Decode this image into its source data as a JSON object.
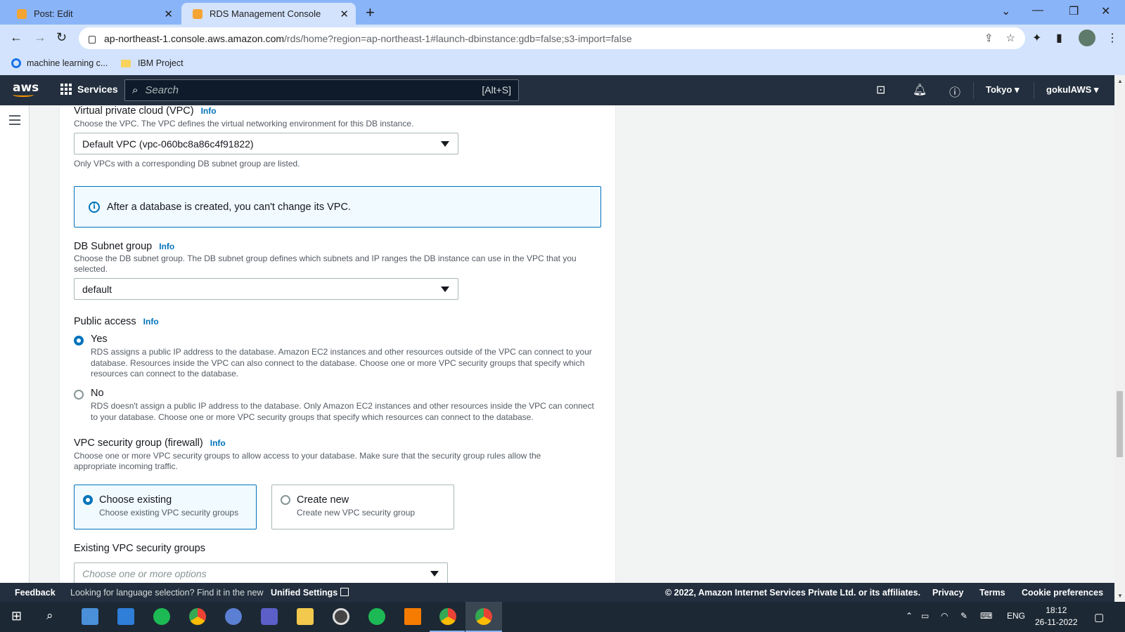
{
  "browser": {
    "tabs": [
      {
        "title": "Post: Edit",
        "favicon_color": "#f4a433"
      },
      {
        "title": "RDS Management Console",
        "favicon_color": "#f4a433"
      }
    ],
    "url_host": "ap-northeast-1.console.aws.amazon.com",
    "url_path": "/rds/home?region=ap-northeast-1#launch-dbinstance:gdb=false;s3-import=false",
    "bookmarks": [
      "machine learning c...",
      "IBM Project"
    ]
  },
  "aws_header": {
    "logo": "aws",
    "services_label": "Services",
    "search_placeholder": "Search",
    "search_shortcut": "[Alt+S]",
    "region": "Tokyo",
    "account": "gokulAWS"
  },
  "form": {
    "vpc": {
      "label": "Virtual private cloud (VPC)",
      "info": "Info",
      "description": "Choose the VPC. The VPC defines the virtual networking environment for this DB instance.",
      "value": "Default VPC (vpc-060bc8a86c4f91822)",
      "hint": "Only VPCs with a corresponding DB subnet group are listed.",
      "alert": "After a database is created, you can't change its VPC."
    },
    "subnet": {
      "label": "DB Subnet group",
      "info": "Info",
      "description": "Choose the DB subnet group. The DB subnet group defines which subnets and IP ranges the DB instance can use in the VPC that you selected.",
      "value": "default"
    },
    "public_access": {
      "label": "Public access",
      "info": "Info",
      "options": [
        {
          "label": "Yes",
          "checked": true,
          "description": "RDS assigns a public IP address to the database. Amazon EC2 instances and other resources outside of the VPC can connect to your database. Resources inside the VPC can also connect to the database. Choose one or more VPC security groups that specify which resources can connect to the database."
        },
        {
          "label": "No",
          "checked": false,
          "description": "RDS doesn't assign a public IP address to the database. Only Amazon EC2 instances and other resources inside the VPC can connect to your database. Choose one or more VPC security groups that specify which resources can connect to the database."
        }
      ]
    },
    "security_group": {
      "label": "VPC security group (firewall)",
      "info": "Info",
      "description": "Choose one or more VPC security groups to allow access to your database. Make sure that the security group rules allow the appropriate incoming traffic.",
      "tiles": [
        {
          "title": "Choose existing",
          "subtitle": "Choose existing VPC security groups",
          "selected": true
        },
        {
          "title": "Create new",
          "subtitle": "Create new VPC security group",
          "selected": false
        }
      ]
    },
    "existing_groups": {
      "label": "Existing VPC security groups",
      "placeholder": "Choose one or more options"
    }
  },
  "footer": {
    "feedback": "Feedback",
    "language_text": "Looking for language selection? Find it in the new",
    "unified_settings": "Unified Settings",
    "copyright": "© 2022, Amazon Internet Services Private Ltd. or its affiliates.",
    "links": [
      "Privacy",
      "Terms",
      "Cookie preferences"
    ]
  },
  "taskbar": {
    "language": "ENG",
    "time": "18:12",
    "date": "26-11-2022"
  },
  "colors": {
    "aws_nav": "#232f3e",
    "accent": "#0073bb",
    "aws_orange": "#ff9900"
  }
}
